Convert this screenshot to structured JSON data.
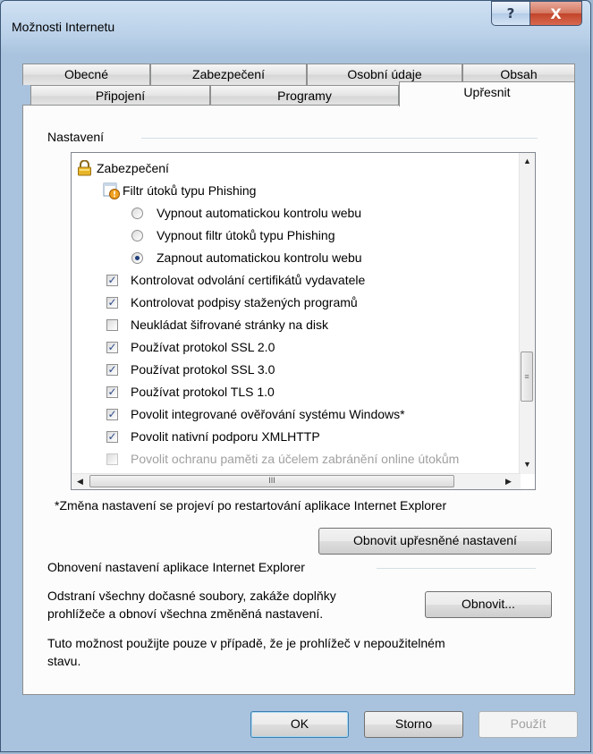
{
  "window": {
    "title": "Možnosti Internetu"
  },
  "tabs_top": [
    "Obecné",
    "Zabezpečení",
    "Osobní údaje",
    "Obsah"
  ],
  "tabs_bottom": [
    "Připojení",
    "Programy",
    "Upřesnit"
  ],
  "settings_group_label": "Nastavení",
  "tree": [
    {
      "label": "Zabezpečení",
      "type": "category",
      "icon": "lock-icon"
    },
    {
      "label": "Filtr útoků typu Phishing",
      "type": "subcategory",
      "icon": "phishing-shield-icon"
    },
    {
      "label": "Vypnout automatickou kontrolu webu",
      "type": "radio",
      "checked": false
    },
    {
      "label": "Vypnout filtr útoků typu Phishing",
      "type": "radio",
      "checked": false
    },
    {
      "label": "Zapnout automatickou kontrolu webu",
      "type": "radio",
      "checked": true
    },
    {
      "label": "Kontrolovat odvolání certifikátů vydavatele",
      "type": "checkbox",
      "checked": true
    },
    {
      "label": "Kontrolovat podpisy stažených programů",
      "type": "checkbox",
      "checked": true
    },
    {
      "label": "Neukládat šifrované stránky na disk",
      "type": "checkbox",
      "checked": false
    },
    {
      "label": "Používat protokol SSL 2.0",
      "type": "checkbox",
      "checked": true
    },
    {
      "label": "Používat protokol SSL 3.0",
      "type": "checkbox",
      "checked": true
    },
    {
      "label": "Používat protokol TLS 1.0",
      "type": "checkbox",
      "checked": true
    },
    {
      "label": "Povolit integrované ověřování systému Windows*",
      "type": "checkbox",
      "checked": true
    },
    {
      "label": "Povolit nativní podporu XMLHTTP",
      "type": "checkbox",
      "checked": true
    },
    {
      "label": "Povolit ochranu paměti za účelem zabránění online útokům",
      "type": "checkbox",
      "checked": false,
      "disabled": true
    }
  ],
  "restart_note": "*Změna nastavení se projeví po restartování aplikace Internet Explorer",
  "restore_advanced_button": "Obnovit upřesněné nastavení",
  "reset_group_label": "Obnovení nastavení aplikace Internet Explorer",
  "reset_description_line1": "Odstraní všechny dočasné soubory, zakáže doplňky",
  "reset_description_line2": "prohlížeče a obnoví všechna změněná nastavení.",
  "reset_button": "Obnovit...",
  "reset_warning_line1": "Tuto možnost použijte pouze v případě, že je prohlížeč v nepoužitelném",
  "reset_warning_line2": "stavu.",
  "footer": {
    "ok": "OK",
    "cancel": "Storno",
    "apply": "Použít"
  },
  "icons": {
    "help": "?",
    "close": "X",
    "check": "✓",
    "scroll_thumb_grip": "≡",
    "hscroll_thumb_grip": "III"
  }
}
